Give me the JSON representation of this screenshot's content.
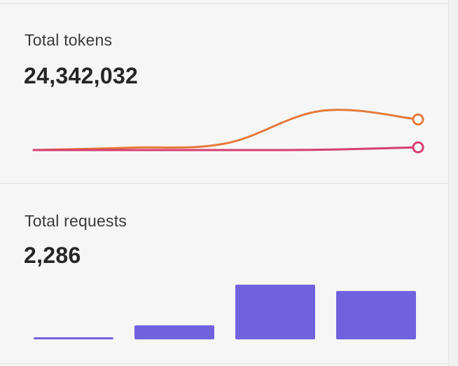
{
  "cards": {
    "tokens": {
      "title": "Total tokens",
      "value": "24,342,032"
    },
    "requests": {
      "title": "Total requests",
      "value": "2,286"
    }
  },
  "colors": {
    "series_orange": "#e5793a",
    "series_pink": "#d63d73",
    "bar_purple": "#7261df"
  },
  "chart_data": [
    {
      "type": "line",
      "x": [
        0,
        1,
        2,
        3,
        4
      ],
      "series": [
        {
          "values": [
            0,
            0.06,
            0.17,
            1.0,
            0.78
          ],
          "color": "#e5793a"
        },
        {
          "values": [
            0,
            0.0,
            0.0,
            0.01,
            0.07
          ],
          "color": "#d63d73"
        }
      ],
      "ylim": [
        0,
        1
      ],
      "grid": false,
      "legend": "none"
    },
    {
      "type": "bar",
      "categories": [
        "",
        "",
        "",
        ""
      ],
      "values": [
        3,
        20,
        78,
        69
      ],
      "ylim": [
        0,
        78
      ],
      "color": "#7261df",
      "grid": false,
      "legend": "none"
    }
  ]
}
